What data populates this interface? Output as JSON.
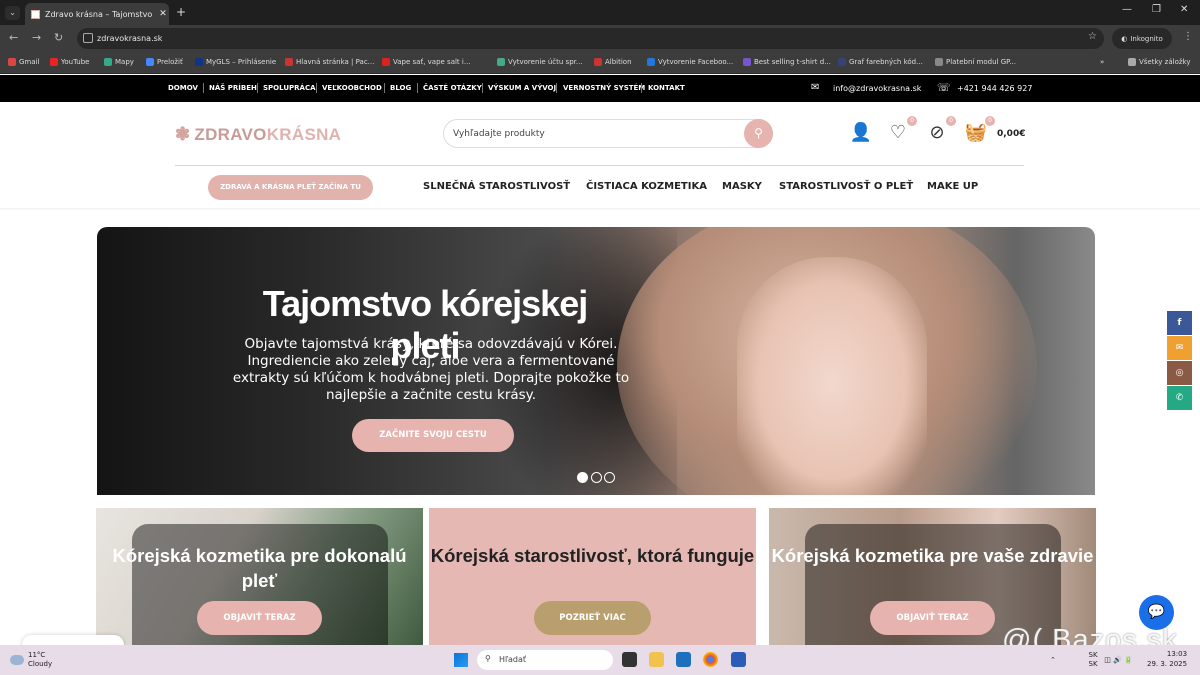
{
  "browser": {
    "tab_title": "Zdravo krásna – Tajomstvo kór",
    "url": "zdravokrasna.sk",
    "incognito_label": "Inkognito",
    "bookmarks": [
      "Gmail",
      "YouTube",
      "Mapy",
      "Preložiť",
      "MyGLS – Prihlásenie",
      "Hlavná stránka | Pac...",
      "Vape sať, vape salt i...",
      "Vytvorenie účtu spr...",
      "Albition",
      "Vytvorenie Faceboo...",
      "Best selling t-shirt d...",
      "Graf farebných kód...",
      "Platební modul GP..."
    ],
    "bookmarks_more": "Všetky záložky"
  },
  "topbar": {
    "nav": [
      "DOMOV",
      "NÁŠ PRÍBEH",
      "SPOLUPRÁCA",
      "VEĽKOOBCHOD",
      "BLOG",
      "ČASTÉ OTÁZKY",
      "VÝSKUM A VÝVOJ",
      "VERNOSTNÝ SYSTÉM",
      "KONTAKT"
    ],
    "email": "info@zdravokrasna.sk",
    "phone": "+421 944 426 927"
  },
  "header": {
    "logo_a": "ZDRAVO",
    "logo_b": "KRÁSNA",
    "search_placeholder": "Vyhľadajte produkty",
    "badges": [
      "0",
      "0",
      "0"
    ],
    "cart_total": "0,00€",
    "pill": "ZDRAVÁ A KRÁSNA PLEŤ ZAČÍNA TU",
    "menu": [
      "SLNEČNÁ STAROSTLIVOSŤ",
      "ČISTIACA KOZMETIKA",
      "MASKY",
      "STAROSTLIVOSŤ O PLEŤ",
      "MAKE UP"
    ]
  },
  "hero": {
    "title": "Tajomstvo kórejskej pleti",
    "text": "Objavte tajomstvá krásy, ktoré sa odovzdávajú v Kórei. Ingrediencie ako zelený čaj, aloe vera a fermentované extrakty sú kľúčom k hodvábnej pleti. Doprajte pokožke to najlepšie a začnite cestu krásy.",
    "button": "ZAČNITE SVOJU CESTU",
    "slides_total": 3,
    "active_slide": 1
  },
  "cards": [
    {
      "title": "Kórejská kozmetika pre dokonalú pleť",
      "button": "OBJAVIŤ TERAZ"
    },
    {
      "title": "Kórejská starostlivosť, ktorá funguje",
      "button": "POZRIEŤ VIAC"
    },
    {
      "title": "Kórejská kozmetika pre vaše zdravie",
      "button": "OBJAVIŤ TERAZ"
    }
  ],
  "social": [
    {
      "icon": "facebook-icon",
      "glyph": "f",
      "color": "#3b5998"
    },
    {
      "icon": "email-icon",
      "glyph": "✉",
      "color": "#f0a030"
    },
    {
      "icon": "instagram-icon",
      "glyph": "◎",
      "color": "#8a5a44"
    },
    {
      "icon": "whatsapp-icon",
      "glyph": "✆",
      "color": "#25a884"
    }
  ],
  "watermark": "@( Bazos.sk",
  "taskbar": {
    "temp": "11°C",
    "weather": "Cloudy",
    "search": "Hľadať",
    "lang1": "SK",
    "lang2": "SK",
    "time": "13:03",
    "date": "29. 3. 2025"
  },
  "colors": {
    "accent": "#e6b3ae",
    "gold": "#b99f6d",
    "black_bar": "#000000"
  }
}
